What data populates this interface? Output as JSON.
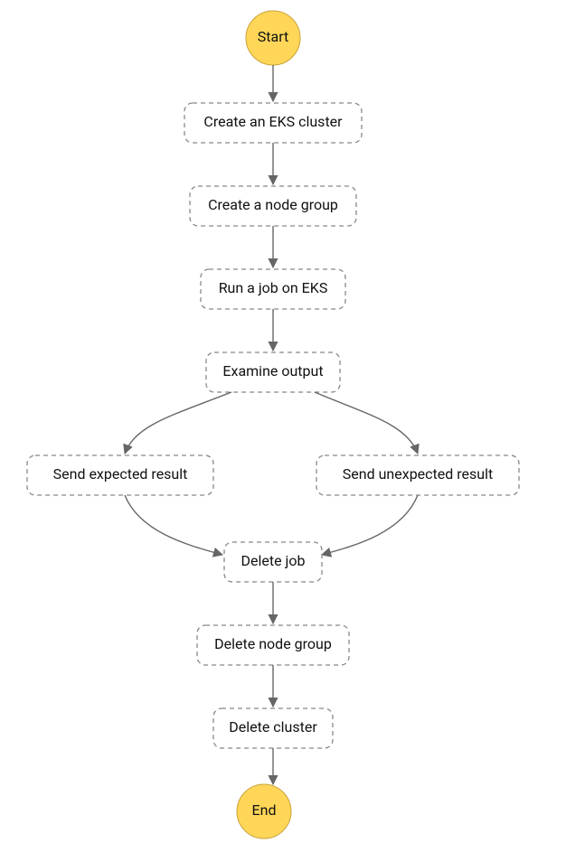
{
  "chart_data": {
    "type": "flowchart",
    "nodes": {
      "start": {
        "label": "Start",
        "shape": "terminal"
      },
      "create_cluster": {
        "label": "Create an EKS cluster",
        "shape": "process"
      },
      "create_ng": {
        "label": "Create a node group",
        "shape": "process"
      },
      "run_job": {
        "label": "Run a job on EKS",
        "shape": "process"
      },
      "examine": {
        "label": "Examine output",
        "shape": "process"
      },
      "send_exp": {
        "label": "Send expected result",
        "shape": "process"
      },
      "send_unexp": {
        "label": "Send unexpected result",
        "shape": "process"
      },
      "delete_job": {
        "label": "Delete job",
        "shape": "process"
      },
      "delete_ng": {
        "label": "Delete node group",
        "shape": "process"
      },
      "delete_cluster": {
        "label": "Delete cluster",
        "shape": "process"
      },
      "end": {
        "label": "End",
        "shape": "terminal"
      }
    },
    "edges": [
      [
        "start",
        "create_cluster"
      ],
      [
        "create_cluster",
        "create_ng"
      ],
      [
        "create_ng",
        "run_job"
      ],
      [
        "run_job",
        "examine"
      ],
      [
        "examine",
        "send_exp"
      ],
      [
        "examine",
        "send_unexp"
      ],
      [
        "send_exp",
        "delete_job"
      ],
      [
        "send_unexp",
        "delete_job"
      ],
      [
        "delete_job",
        "delete_ng"
      ],
      [
        "delete_ng",
        "delete_cluster"
      ],
      [
        "delete_cluster",
        "end"
      ]
    ]
  }
}
